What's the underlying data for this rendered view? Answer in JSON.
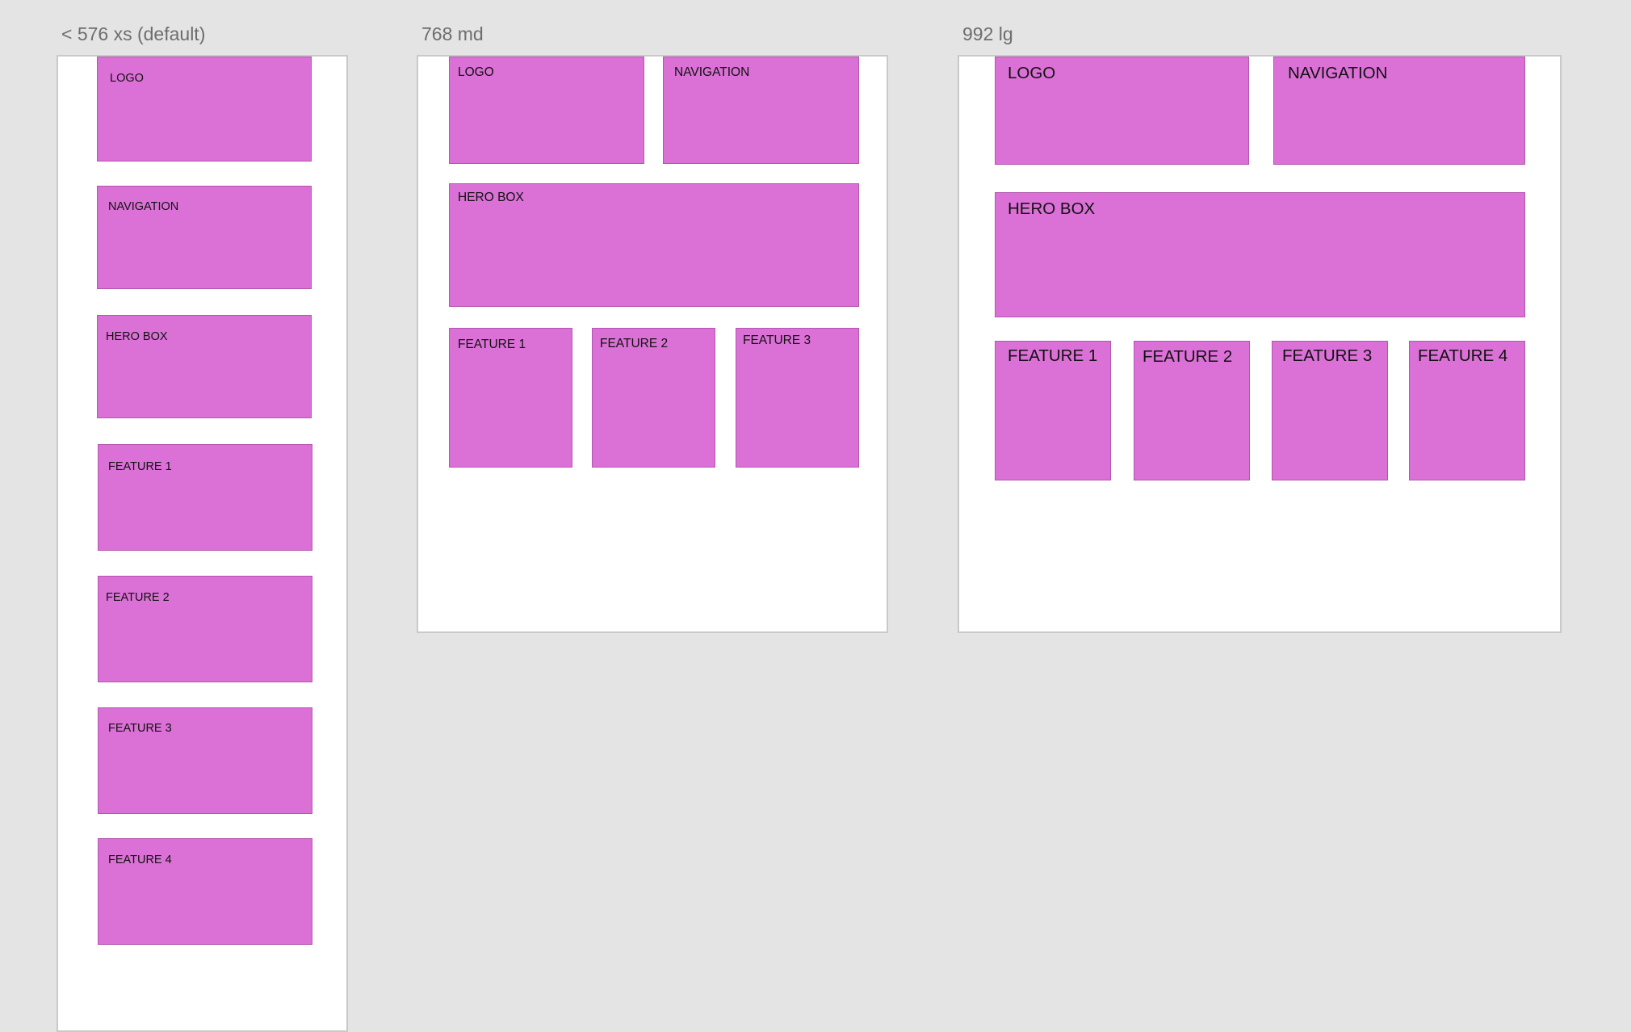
{
  "artboards": {
    "xs": {
      "label": "< 576 xs (default)",
      "boxes": {
        "logo": "LOGO",
        "navigation": "NAVIGATION",
        "hero": "HERO BOX",
        "feature1": "FEATURE 1",
        "feature2": "FEATURE 2",
        "feature3": "FEATURE 3",
        "feature4": "FEATURE 4"
      }
    },
    "md": {
      "label": "768 md",
      "boxes": {
        "logo": "LOGO",
        "navigation": "NAVIGATION",
        "hero": "HERO BOX",
        "feature1": "FEATURE 1",
        "feature2": "FEATURE 2",
        "feature3": "FEATURE 3"
      }
    },
    "lg": {
      "label": "992 lg",
      "boxes": {
        "logo": "LOGO",
        "navigation": "NAVIGATION",
        "hero": "HERO BOX",
        "feature1": "FEATURE 1",
        "feature2": "FEATURE 2",
        "feature3": "FEATURE 3",
        "feature4": "FEATURE 4"
      }
    }
  },
  "colors": {
    "canvas": "#e4e4e4",
    "artboard": "#ffffff",
    "box_fill": "#db71d6",
    "label_text": "#6d6d6d"
  }
}
